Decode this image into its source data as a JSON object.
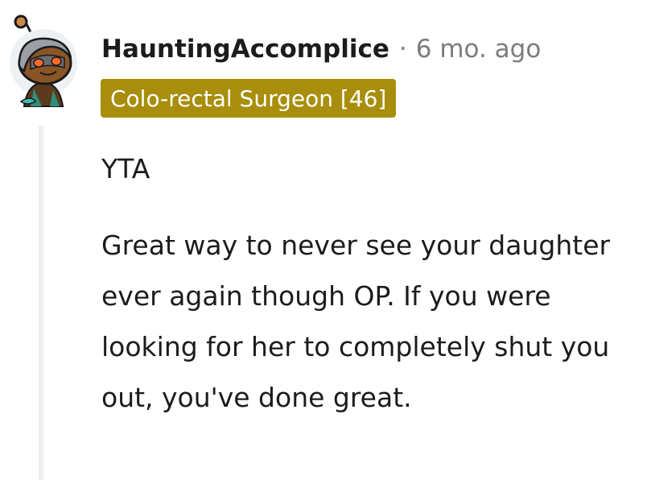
{
  "comment": {
    "username": "HauntingAccomplice",
    "separator": "·",
    "timestamp": "6 mo. ago",
    "flair": "Colo-rectal Surgeon [46]",
    "body": [
      "YTA",
      "Great way to never see your daughter ever again though OP. If you were looking for her to completely shut you out, you've done great."
    ]
  },
  "colors": {
    "flair_background": "#a88e0c",
    "flair_text": "#ffffff",
    "username": "#1c1c1c",
    "meta_text": "#7c7c7c",
    "thread_line": "#edeff1"
  },
  "icons": {
    "avatar": "reddit-snoo-avatar-icon"
  }
}
